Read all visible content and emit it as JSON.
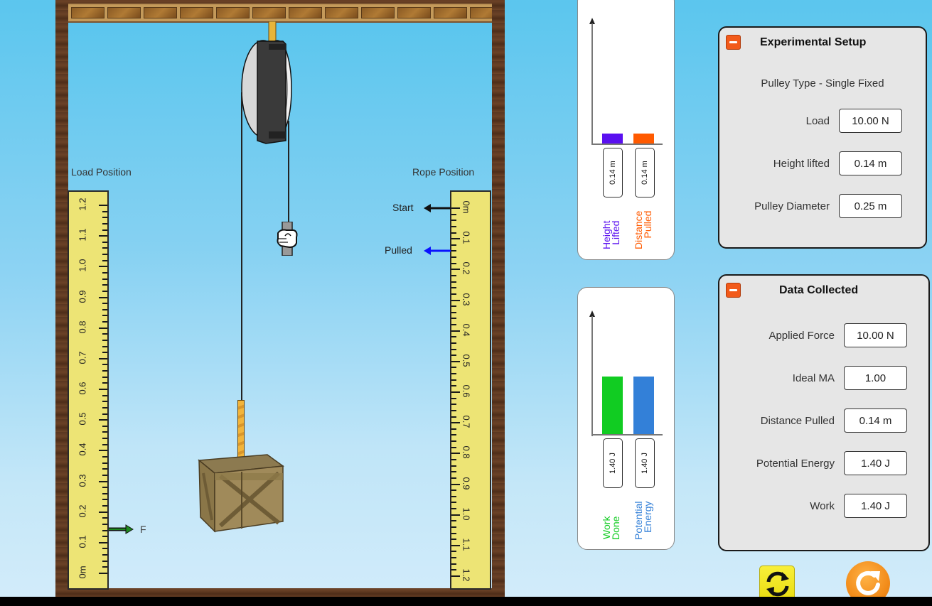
{
  "scene": {
    "load_position_label": "Load Position",
    "rope_position_label": "Rope Position",
    "start_label": "Start",
    "pulled_label": "Pulled",
    "force_label": "F",
    "ruler_unit": "m",
    "ruler_ticks": [
      "0",
      "0.1",
      "0.2",
      "0.3",
      "0.4",
      "0.5",
      "0.6",
      "0.7",
      "0.8",
      "0.9",
      "1.0",
      "1.1",
      "1.2"
    ],
    "load_position_value_m": 0.14,
    "rope_start_value_m": 0.0,
    "rope_pulled_value_m": 0.14,
    "colors": {
      "start_arrow": "#111111",
      "pulled_arrow": "#0a12ff",
      "force_arrow": "#1e7a1e",
      "ruler": "#ede475"
    }
  },
  "charts": {
    "distance": {
      "bars": [
        {
          "caption_line1": "Height",
          "caption_line2": "Lifted",
          "value": 0.14,
          "value_label": "0.14 m",
          "color": "#5a10f0"
        },
        {
          "caption_line1": "Distance",
          "caption_line2": "Pulled",
          "value": 0.14,
          "value_label": "0.14 m",
          "color": "#ff5a00"
        }
      ],
      "scale_max": 1.2
    },
    "energy": {
      "bars": [
        {
          "caption_line1": "Work",
          "caption_line2": "Done",
          "value": 1.4,
          "value_label": "1.40 J",
          "color": "#11cc22"
        },
        {
          "caption_line1": "Potential",
          "caption_line2": "Energy",
          "value": 1.4,
          "value_label": "1.40 J",
          "color": "#3380d8"
        }
      ],
      "scale_max": 2.9
    }
  },
  "chart_data": [
    {
      "type": "bar",
      "title": "",
      "categories": [
        "Height Lifted",
        "Distance Pulled"
      ],
      "values": [
        0.14,
        0.14
      ],
      "unit": "m",
      "xlabel": "",
      "ylabel": ""
    },
    {
      "type": "bar",
      "title": "",
      "categories": [
        "Work Done",
        "Potential Energy"
      ],
      "values": [
        1.4,
        1.4
      ],
      "unit": "J",
      "xlabel": "",
      "ylabel": ""
    }
  ],
  "setup_panel": {
    "title": "Experimental Setup",
    "pulley_type": "Pulley Type - Single Fixed",
    "fields": [
      {
        "label": "Load",
        "value": "10.00 N"
      },
      {
        "label": "Height lifted",
        "value": "0.14 m"
      },
      {
        "label": "Pulley Diameter",
        "value": "0.25 m"
      }
    ]
  },
  "data_panel": {
    "title": "Data Collected",
    "fields": [
      {
        "label": "Applied Force",
        "value": "10.00 N"
      },
      {
        "label": "Ideal MA",
        "value": "1.00"
      },
      {
        "label": "Distance Pulled",
        "value": "0.14 m"
      },
      {
        "label": "Potential Energy",
        "value": "1.40 J"
      },
      {
        "label": "Work",
        "value": "1.40 J"
      }
    ]
  },
  "controls": {
    "reset_icon": "reset-cycle-icon",
    "replay_icon": "replay-icon"
  }
}
